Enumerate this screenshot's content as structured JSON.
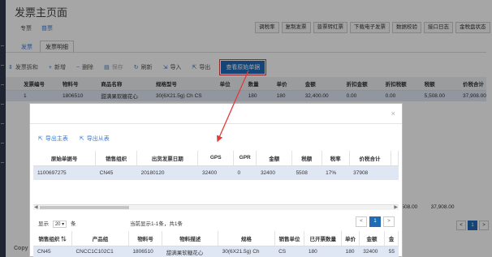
{
  "page": {
    "title": "发票主页面",
    "top_tabs": [
      "专票",
      "普票"
    ],
    "actions": [
      "调税率",
      "复制发票",
      "普票转红票",
      "下载电子发票",
      "数据校验",
      "接口日志",
      "金税盘状态"
    ],
    "sub_tabs": [
      "发票",
      "发票明细"
    ],
    "toolbar": {
      "split": "发票拆和",
      "add": "新增",
      "delete": "删除",
      "save": "保存",
      "refresh": "刷新",
      "import": "导入",
      "export": "导出",
      "view_source": "查看原始单据"
    },
    "grid": {
      "columns": [
        "发票编号",
        "物料号",
        "商品名称",
        "规格型号",
        "单位",
        "数量",
        "单价",
        "金额",
        "折扣金额",
        "折扣税额",
        "税额",
        "价税合计"
      ],
      "row": [
        "1",
        "1806510",
        "甜满果软糖花心",
        "30(6X21.5g) Ch",
        "CS",
        "180",
        "180",
        "32,400.00",
        "0.00",
        "0.00",
        "5,508.00",
        "37,908.00"
      ]
    },
    "footer_totals": [
      "5,508.00",
      "37,908.00"
    ],
    "pager": {
      "prev": "<",
      "current": "1",
      "next": ">"
    },
    "copyright": "Copy"
  },
  "modal": {
    "close": "×",
    "toolbar": {
      "export_main": "导出主表",
      "export_detail": "导出从表"
    },
    "main_table": {
      "columns": [
        "原始单据号",
        "销售组织",
        "出货发票日期",
        "GPS",
        "GPR",
        "金额",
        "税额",
        "税率",
        "价税合计"
      ],
      "row": [
        "1100697275",
        "CN45",
        "20180120",
        "32400",
        "0",
        "32400",
        "5508",
        "17%",
        "37908"
      ]
    },
    "pagination": {
      "show": "显示",
      "page_size": "20",
      "unit": "条",
      "summary": "当前显示1-1条，共1条",
      "prev": "<",
      "current": "1",
      "next": ">"
    },
    "detail_table": {
      "columns": [
        "销售组织",
        "产品组",
        "物料号",
        "物料描述",
        "规格",
        "销售单位",
        "已开票数量",
        "单价",
        "金额",
        "金"
      ],
      "row": [
        "CN45",
        "CNCC1C102C1",
        "1806510",
        "甜满果软糖花心",
        "30(6X21.5g) Ch",
        "CS",
        "180",
        "180",
        "32400",
        "55"
      ]
    }
  },
  "colors": {
    "primary": "#1f6bb5",
    "highlight": "#e23b3b",
    "row_selected": "#dfe7f5"
  }
}
